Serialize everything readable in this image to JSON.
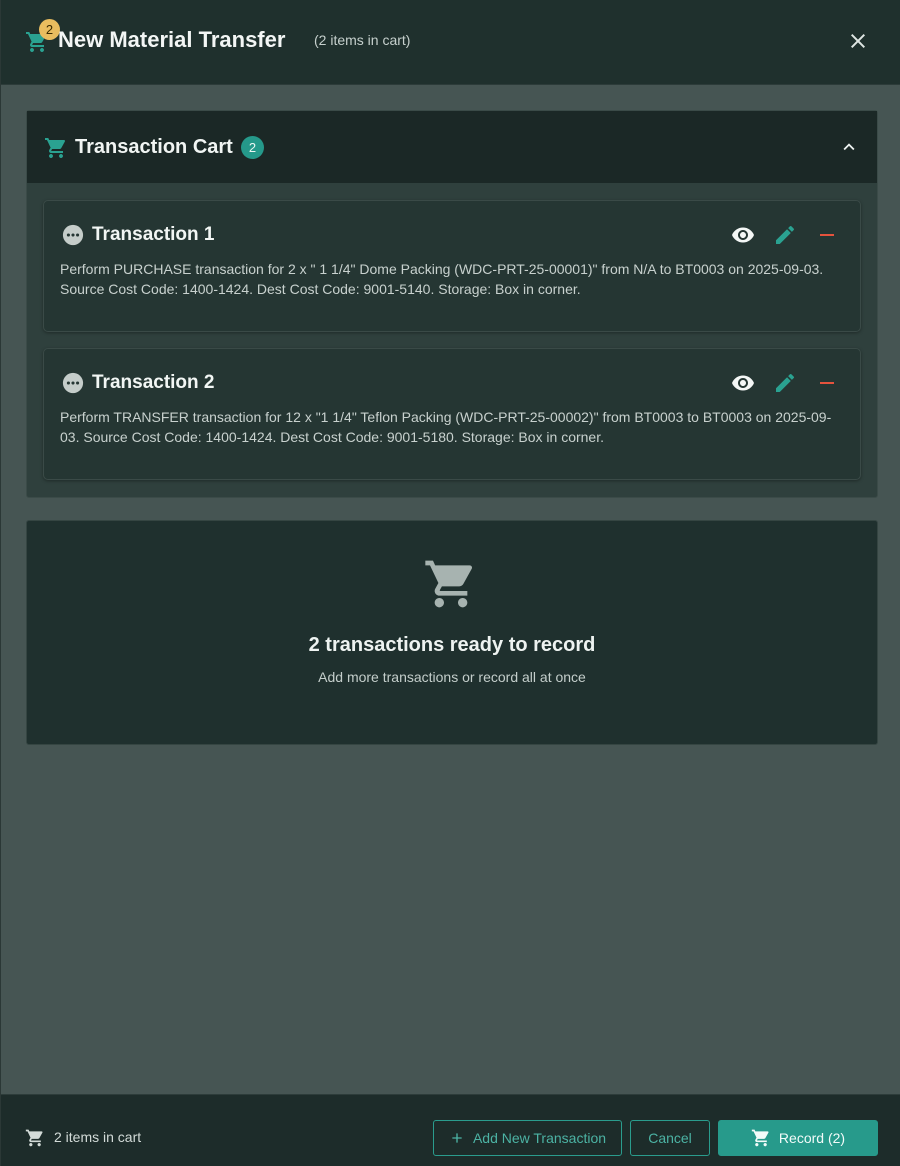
{
  "header": {
    "cart_badge": "2",
    "title": "New Material Transfer",
    "subtitle": "(2 items in cart)"
  },
  "cart": {
    "title": "Transaction Cart",
    "badge": "2",
    "transactions": [
      {
        "title": "Transaction 1",
        "description": "Perform PURCHASE transaction for 2 x \" 1 1/4\" Dome Packing (WDC-PRT-25-00001)\" from N/A to BT0003 on 2025-09-03. Source Cost Code: 1400-1424. Dest Cost Code: 9001-5140. Storage: Box in corner."
      },
      {
        "title": "Transaction 2",
        "description": "Perform TRANSFER transaction for 12 x \"1 1/4\" Teflon Packing (WDC-PRT-25-00002)\" from BT0003 to BT0003 on 2025-09-03. Source Cost Code: 1400-1424. Dest Cost Code: 9001-5180. Storage: Box in corner."
      }
    ]
  },
  "summary": {
    "title": "2 transactions ready to record",
    "subtitle": "Add more transactions or record all at once"
  },
  "footer": {
    "count_text": "2 items in cart",
    "add_label": "Add New Transaction",
    "cancel_label": "Cancel",
    "record_label": "Record (2)"
  },
  "colors": {
    "accent": "#279a8b",
    "badge_warning": "#e9bd5f",
    "danger": "#e5533d",
    "header_bg": "#1f302d"
  },
  "icons": {
    "header": "cart-icon",
    "close": "close-icon",
    "collapse": "chevron-up-icon",
    "transaction": "more-horizontal-icon",
    "view": "eye-icon",
    "edit": "pencil-icon",
    "remove": "minus-icon",
    "add": "plus-icon"
  }
}
